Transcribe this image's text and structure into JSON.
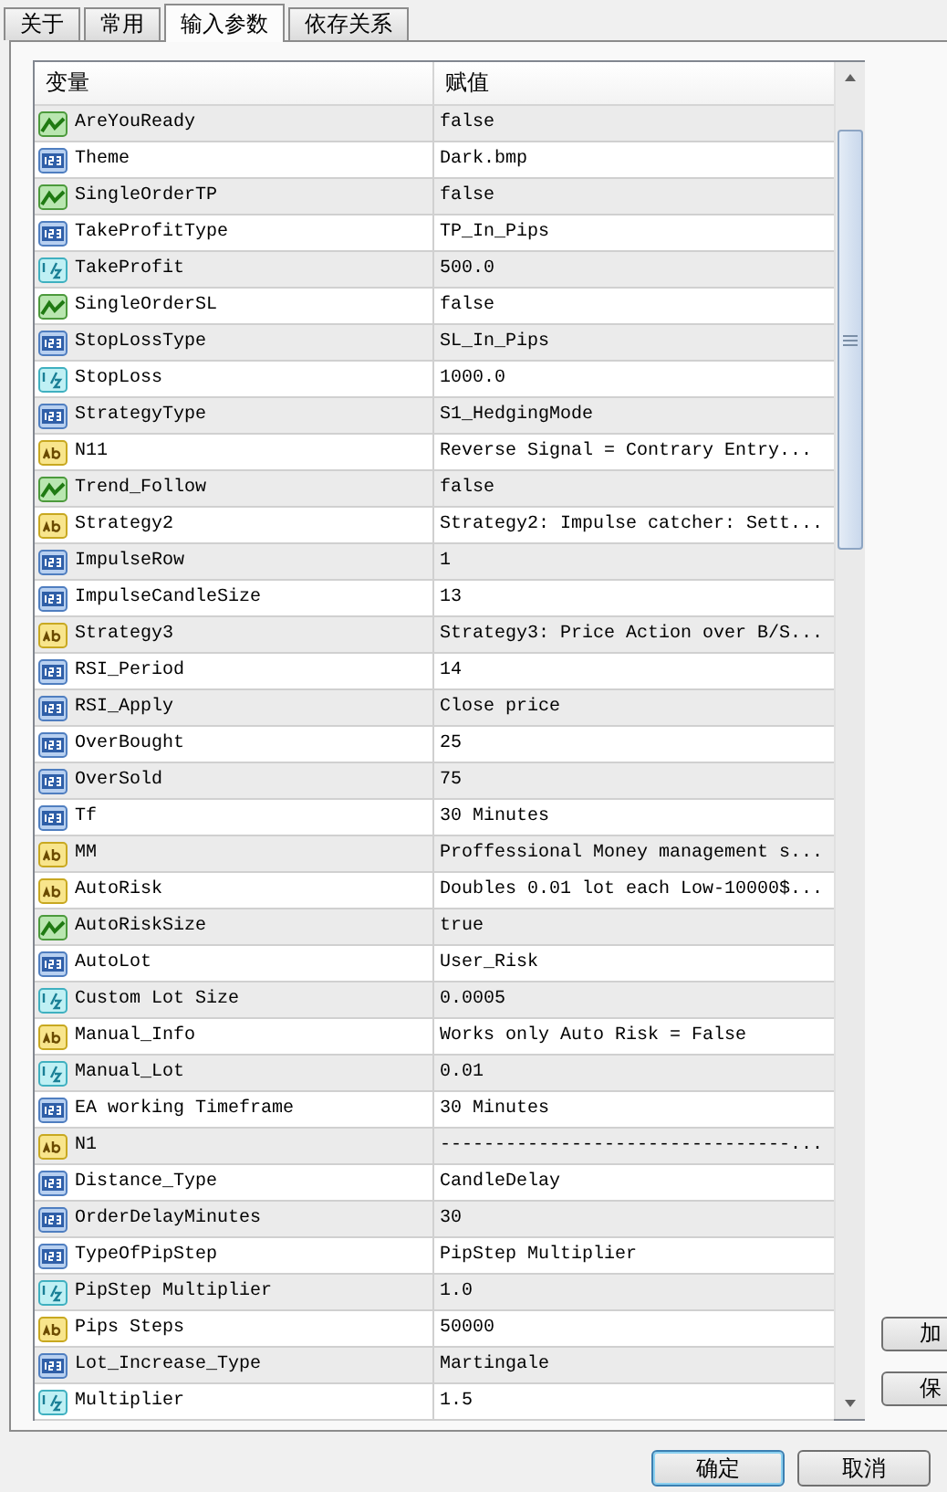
{
  "tabs": [
    {
      "label": "关于",
      "selected": false
    },
    {
      "label": "常用",
      "selected": false
    },
    {
      "label": "输入参数",
      "selected": true
    },
    {
      "label": "依存关系",
      "selected": false
    }
  ],
  "table": {
    "columns": [
      "变量",
      "赋值"
    ],
    "rows": [
      {
        "kind": "bool",
        "name": "AreYouReady",
        "value": "false"
      },
      {
        "kind": "int",
        "name": "Theme",
        "value": "Dark.bmp"
      },
      {
        "kind": "bool",
        "name": "SingleOrderTP",
        "value": "false"
      },
      {
        "kind": "int",
        "name": "TakeProfitType",
        "value": "TP_In_Pips"
      },
      {
        "kind": "double",
        "name": "TakeProfit",
        "value": "500.0"
      },
      {
        "kind": "bool",
        "name": "SingleOrderSL",
        "value": "false"
      },
      {
        "kind": "int",
        "name": "StopLossType",
        "value": "SL_In_Pips"
      },
      {
        "kind": "double",
        "name": "StopLoss",
        "value": "1000.0"
      },
      {
        "kind": "int",
        "name": "StrategyType",
        "value": "S1_HedgingMode"
      },
      {
        "kind": "string",
        "name": "N11",
        "value": "Reverse Signal  = Contrary Entry..."
      },
      {
        "kind": "bool",
        "name": "Trend_Follow",
        "value": "false"
      },
      {
        "kind": "string",
        "name": "Strategy2",
        "value": "Strategy2: Impulse catcher: Sett..."
      },
      {
        "kind": "int",
        "name": "ImpulseRow",
        "value": "1"
      },
      {
        "kind": "int",
        "name": "ImpulseCandleSize",
        "value": "13"
      },
      {
        "kind": "string",
        "name": "Strategy3",
        "value": "Strategy3: Price Action over B/S..."
      },
      {
        "kind": "int",
        "name": "RSI_Period",
        "value": "14"
      },
      {
        "kind": "int",
        "name": "RSI_Apply",
        "value": "Close price"
      },
      {
        "kind": "int",
        "name": "OverBought",
        "value": "25"
      },
      {
        "kind": "int",
        "name": "OverSold",
        "value": "75"
      },
      {
        "kind": "int",
        "name": "Tf",
        "value": "30 Minutes"
      },
      {
        "kind": "string",
        "name": "MM",
        "value": "Proffessional Money management s..."
      },
      {
        "kind": "string",
        "name": "AutoRisk",
        "value": "Doubles 0.01 lot each Low-10000$..."
      },
      {
        "kind": "bool",
        "name": "AutoRiskSize",
        "value": "true"
      },
      {
        "kind": "int",
        "name": "AutoLot",
        "value": "User_Risk"
      },
      {
        "kind": "double",
        "name": "Custom Lot Size",
        "value": "0.0005"
      },
      {
        "kind": "string",
        "name": "Manual_Info",
        "value": "Works only Auto Risk = False"
      },
      {
        "kind": "double",
        "name": "Manual_Lot",
        "value": "0.01"
      },
      {
        "kind": "int",
        "name": "EA working Timeframe",
        "value": "30 Minutes"
      },
      {
        "kind": "string",
        "name": "N1",
        "value": "--------------------------------..."
      },
      {
        "kind": "int",
        "name": "Distance_Type",
        "value": "CandleDelay"
      },
      {
        "kind": "int",
        "name": "OrderDelayMinutes",
        "value": "30"
      },
      {
        "kind": "int",
        "name": "TypeOfPipStep",
        "value": "PipStep Multiplier"
      },
      {
        "kind": "double",
        "name": "PipStep Multiplier",
        "value": "1.0"
      },
      {
        "kind": "string",
        "name": "Pips Steps",
        "value": "50000"
      },
      {
        "kind": "int",
        "name": "Lot_Increase_Type",
        "value": "Martingale"
      },
      {
        "kind": "double",
        "name": "Multiplier",
        "value": "1.5"
      }
    ]
  },
  "side_buttons": [
    "加",
    "保"
  ],
  "buttons": [
    "确定",
    "取消"
  ]
}
